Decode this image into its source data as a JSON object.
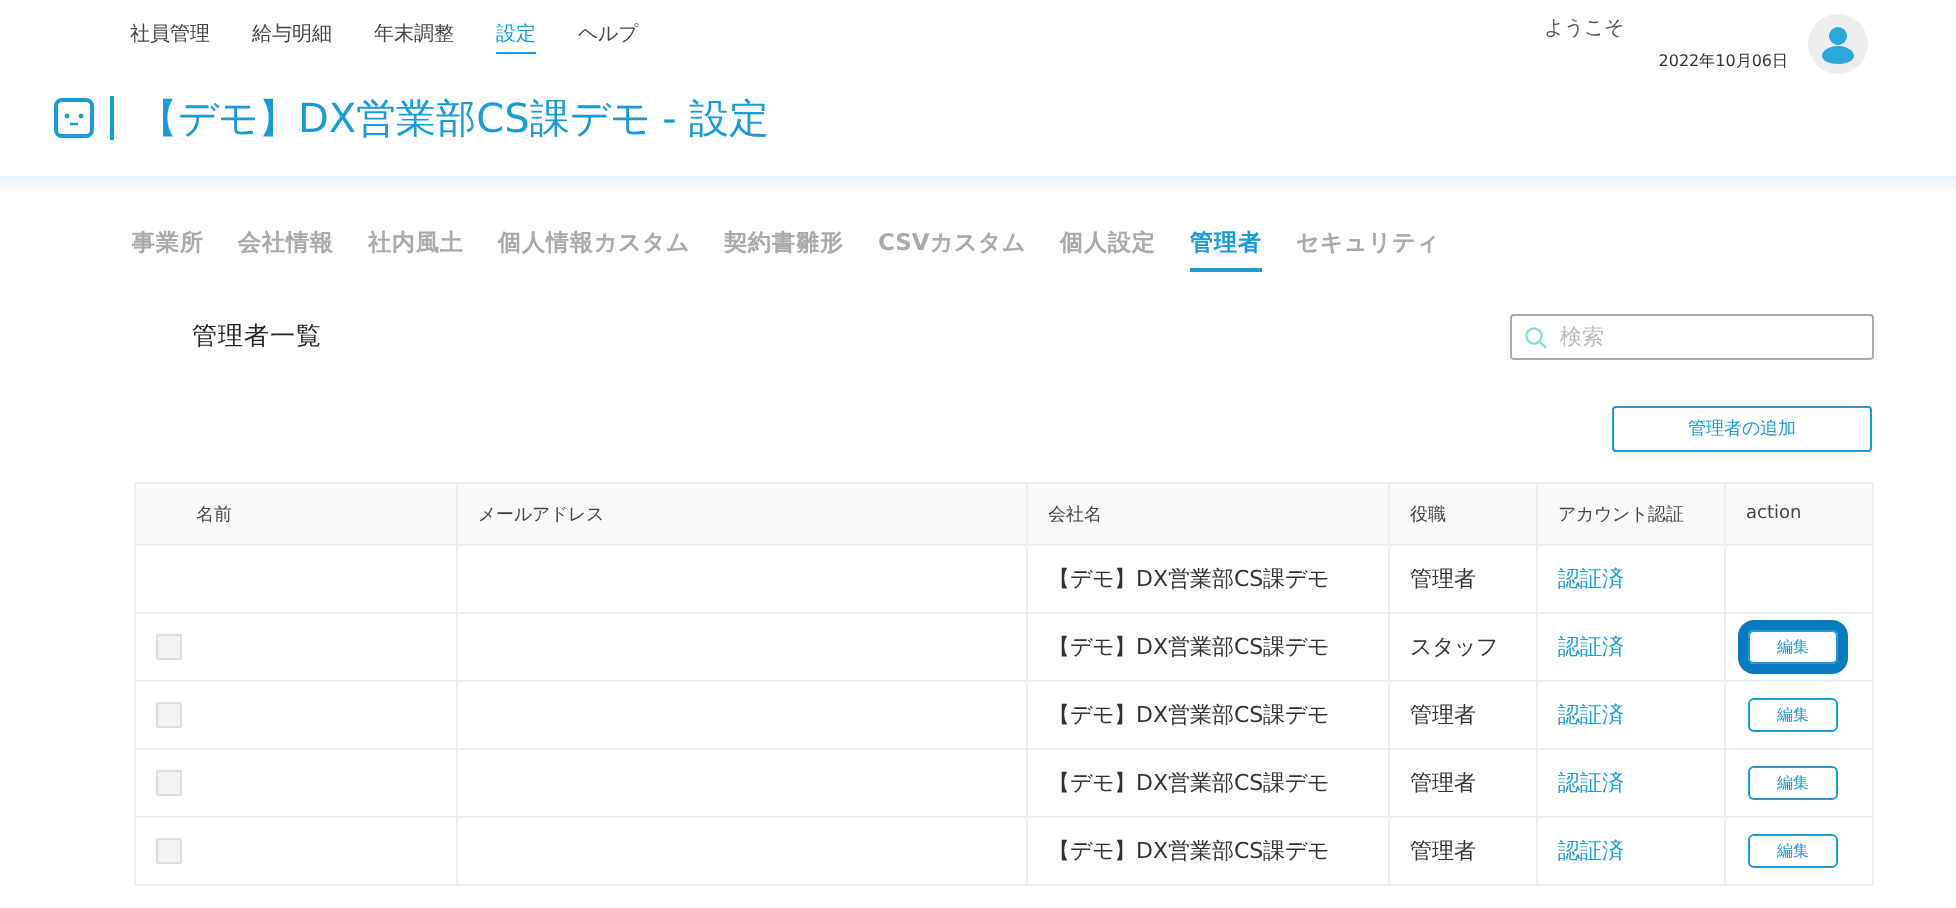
{
  "top_nav": [
    {
      "label": "社員管理",
      "selected": false
    },
    {
      "label": "給与明細",
      "selected": false
    },
    {
      "label": "年末調整",
      "selected": false
    },
    {
      "label": "設定",
      "selected": true
    },
    {
      "label": "ヘルプ",
      "selected": false
    }
  ],
  "user": {
    "greeting": "ようこそ",
    "date": "2022年10月06日"
  },
  "page_title": "【デモ】DX営業部CS課デモ - 設定",
  "tabs": [
    {
      "label": "事業所",
      "selected": false
    },
    {
      "label": "会社情報",
      "selected": false
    },
    {
      "label": "社内風土",
      "selected": false
    },
    {
      "label": "個人情報カスタム",
      "selected": false
    },
    {
      "label": "契約書雛形",
      "selected": false
    },
    {
      "label": "CSVカスタム",
      "selected": false
    },
    {
      "label": "個人設定",
      "selected": false
    },
    {
      "label": "管理者",
      "selected": true
    },
    {
      "label": "セキュリティ",
      "selected": false
    }
  ],
  "section_title": "管理者一覧",
  "search": {
    "placeholder": "検索"
  },
  "add_button": "管理者の追加",
  "table": {
    "columns": [
      "名前",
      "メールアドレス",
      "会社名",
      "役職",
      "アカウント認証",
      "action"
    ],
    "rows": [
      {
        "kind": "owner",
        "company": "【デモ】DX営業部CS課デモ",
        "role": "管理者",
        "auth": "認証済"
      },
      {
        "kind": "member",
        "checked": false,
        "company": "【デモ】DX営業部CS課デモ",
        "role": "スタッフ",
        "auth": "認証済",
        "action": "編集",
        "focused": true
      },
      {
        "kind": "member",
        "checked": false,
        "company": "【デモ】DX営業部CS課デモ",
        "role": "管理者",
        "auth": "認証済",
        "action": "編集",
        "focused": false
      },
      {
        "kind": "member",
        "checked": false,
        "company": "【デモ】DX営業部CS課デモ",
        "role": "管理者",
        "auth": "認証済",
        "action": "編集",
        "focused": false
      },
      {
        "kind": "member",
        "checked": false,
        "company": "【デモ】DX営業部CS課デモ",
        "role": "管理者",
        "auth": "認証済",
        "action": "編集",
        "focused": false
      }
    ]
  }
}
